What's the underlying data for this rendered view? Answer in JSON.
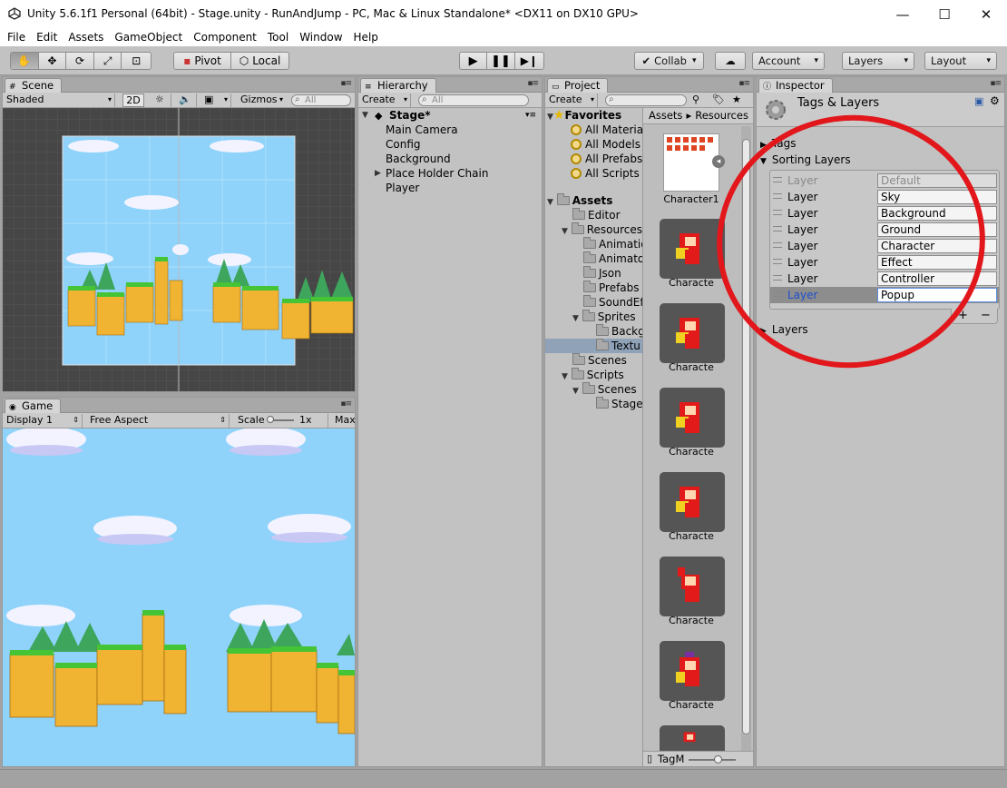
{
  "window": {
    "title": "Unity 5.6.1f1 Personal (64bit) - Stage.unity - RunAndJump - PC, Mac & Linux Standalone* <DX11 on DX10 GPU>",
    "minimize": "—",
    "maximize": "☐",
    "close": "✕"
  },
  "menu": [
    "File",
    "Edit",
    "Assets",
    "GameObject",
    "Component",
    "Tool",
    "Window",
    "Help"
  ],
  "toolbar": {
    "pivot": "Pivot",
    "local": "Local",
    "collab": "Collab",
    "account": "Account",
    "layers": "Layers",
    "layout": "Layout"
  },
  "scene": {
    "tab": "Scene",
    "shading": "Shaded",
    "mode2d": "2D",
    "gizmos": "Gizmos",
    "search_placeholder": "All"
  },
  "game": {
    "tab": "Game",
    "display": "Display 1",
    "aspect": "Free Aspect",
    "scale_label": "Scale",
    "scale_value": "1x",
    "maximize": "Maxi"
  },
  "hierarchy": {
    "tab": "Hierarchy",
    "create": "Create",
    "search_placeholder": "All",
    "scene_name": "Stage*",
    "items": [
      "Main Camera",
      "Config",
      "Background",
      "Place Holder Chain",
      "Player"
    ]
  },
  "project": {
    "tab": "Project",
    "create": "Create",
    "favorites": {
      "label": "Favorites",
      "items": [
        "All Materia",
        "All Models",
        "All Prefabs",
        "All Scripts"
      ]
    },
    "assets": {
      "label": "Assets",
      "tree": [
        "Editor",
        "Resources",
        "Animatio",
        "Animato",
        "Json",
        "Prefabs",
        "SoundEf",
        "Sprites",
        "Backg",
        "Textu",
        "Scenes",
        "Scripts",
        "Scenes",
        "Stage"
      ]
    },
    "breadcrumb": [
      "Assets",
      "Resources"
    ],
    "thumbs": [
      "Character1",
      "Characte",
      "Characte",
      "Characte",
      "Characte",
      "Characte",
      "Characte"
    ],
    "footer_file": "TagM"
  },
  "inspector": {
    "tab": "Inspector",
    "title": "Tags & Layers",
    "tags": "Tags",
    "sorting_layers": "Sorting Layers",
    "layers": "Layers",
    "layer_label": "Layer",
    "sorting": [
      "Default",
      "Sky",
      "Background",
      "Ground",
      "Character",
      "Effect",
      "Controller",
      "Popup"
    ],
    "add": "+",
    "remove": "−"
  },
  "colors": {
    "sky": "#8fd3fb",
    "annotation": "#e2171b",
    "selection": "#3e7de5"
  }
}
